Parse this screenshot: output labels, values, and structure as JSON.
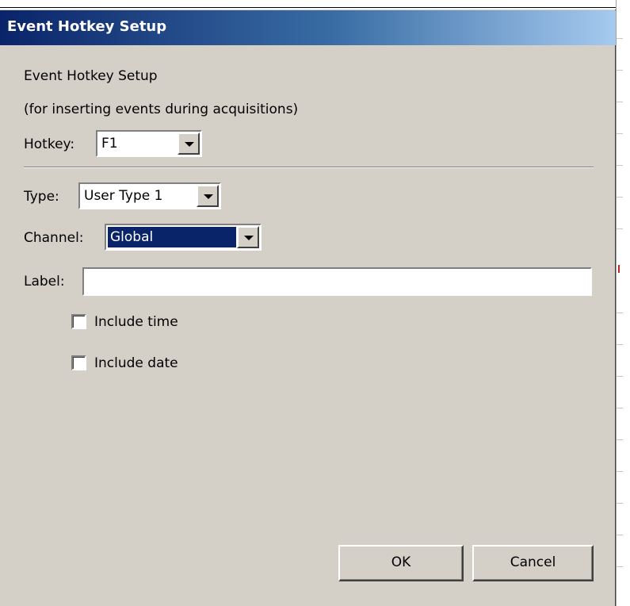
{
  "window": {
    "title": "Event Hotkey Setup"
  },
  "header": {
    "heading": "Event Hotkey Setup",
    "subheading": "(for inserting events during acquisitions)"
  },
  "hotkey": {
    "label": "Hotkey:",
    "value": "F1"
  },
  "type": {
    "label": "Type:",
    "value": "User Type 1"
  },
  "channel": {
    "label": "Channel:",
    "value": "Global"
  },
  "label_field": {
    "label": "Label:",
    "value": ""
  },
  "options": {
    "include_time": "Include time",
    "include_date": "Include date"
  },
  "buttons": {
    "ok": "OK",
    "cancel": "Cancel"
  },
  "colors": {
    "title_start": "#0a246a",
    "title_end": "#a6caf0",
    "dialog_bg": "#d4d0c8",
    "selection": "#0a246a"
  },
  "icons": {
    "dropdown": "chevron-down-icon"
  }
}
